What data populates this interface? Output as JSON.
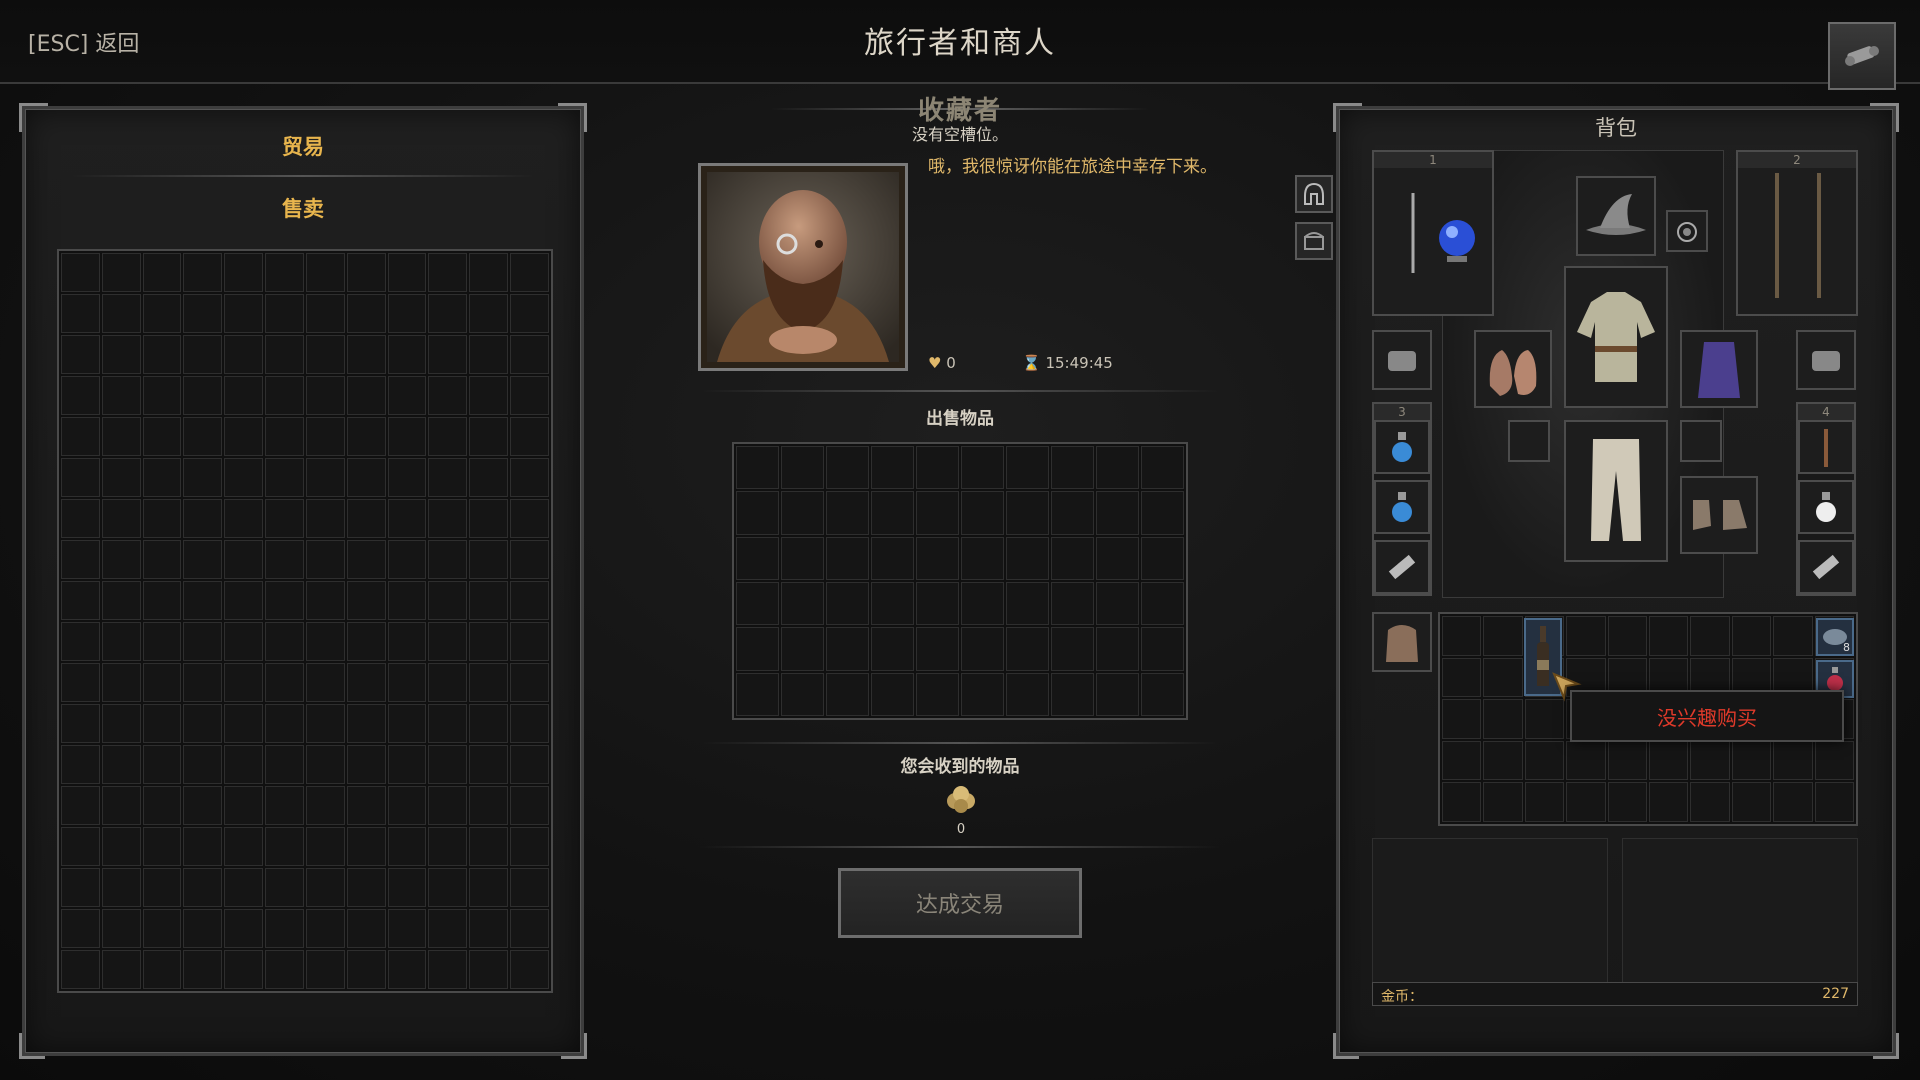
{
  "header": {
    "back_label": "[ESC] 返回",
    "title": "旅行者和商人"
  },
  "left_panel": {
    "tab_trade": "贸易",
    "tab_sell": "售卖",
    "grid": {
      "cols": 12,
      "rows": 18
    }
  },
  "merchant": {
    "name": "收藏者",
    "status": "没有空槽位。",
    "dialogue": "哦，我很惊讶你能在旅途中幸存下来。",
    "affinity": "0",
    "timer": "15:49:45"
  },
  "trade": {
    "sell_items_label": "出售物品",
    "sell_grid": {
      "cols": 10,
      "rows": 6
    },
    "receive_label": "您会收到的物品",
    "receive_amount": "0",
    "deal_button": "达成交易"
  },
  "backpack": {
    "title": "背包",
    "slot_1": "1",
    "slot_2": "2",
    "slot_3": "3",
    "slot_4": "4",
    "stack_count": "8",
    "grid": {
      "cols": 10,
      "rows": 5
    },
    "tooltip": "没兴趣购买",
    "gold_label": "金币：",
    "gold_value": "227"
  },
  "colors": {
    "accent_gold": "#e8b54d",
    "warning_red": "#e03a2a"
  }
}
